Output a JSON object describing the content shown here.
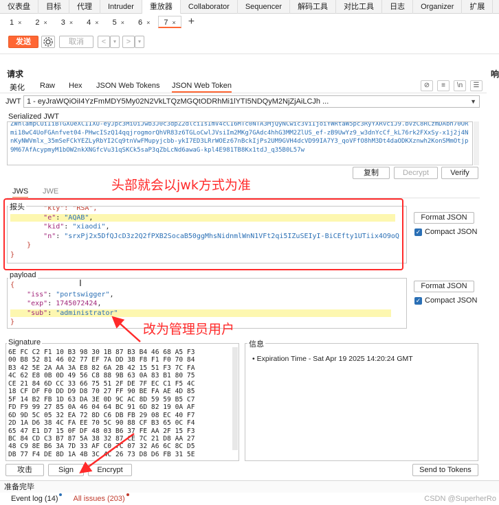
{
  "top_tabs": [
    "仪表盘",
    "目标",
    "代理",
    "Intruder",
    "重放器",
    "Collaborator",
    "Sequencer",
    "解码工具",
    "对比工具",
    "日志",
    "Organizer",
    "扩展",
    "学"
  ],
  "active_top_tab": "重放器",
  "repeater_tabs": [
    {
      "label": "1",
      "close": "×"
    },
    {
      "label": "2",
      "close": "×"
    },
    {
      "label": "3",
      "close": "×"
    },
    {
      "label": "4",
      "close": "×"
    },
    {
      "label": "5",
      "close": "×"
    },
    {
      "label": "6",
      "close": "×"
    },
    {
      "label": "7",
      "close": "×"
    }
  ],
  "add_tab_glyph": "+",
  "toolbar": {
    "send_label": "发送",
    "cancel_label": "取消",
    "back_glyph": "<",
    "fwd_glyph": ">",
    "dropdown_glyph": "▾"
  },
  "request": {
    "title": "请求",
    "response_title": "响",
    "subtabs": [
      "美化",
      "Raw",
      "Hex",
      "JSON Web Tokens",
      "JSON Web Token"
    ],
    "active_subtab": "JSON Web Token"
  },
  "jwt": {
    "label": "JWT",
    "selected": "1 - eyJraWQiOiI4YzFmMDY5My02N2VkLTQzMGQtODRhMi1lYTI5NDQyM2NjZjAiLCJh ...",
    "serialized_label": "Serialized JWT",
    "serialized_text": "ZWhlampCUiIiBTGXUeXCIIXU-eyJpc3MiOiJwb3J0c3dpZ2dlciIsImV4cCI6MTc0NTA3MjQyNCwic3ViIjoiYWRtaW5pc3RyYXRvciJ9.bvzC8RCzmDAbh70ORmi18wC4UoFGAnfvet04-PHwcISzQ14qqjrogmorQhVR83z6TGLoCwlJVsiIm2MKg7GAdc4hhG3MM2ZlUS_ef-zB9UwYz9_w3dnYcCf_kL76rk2FXxSy-x1j2j4NnKyNWVmlx_35mSeFCkYEZLyRbYI2Cq9tnVwFMupyjcbb-ykI7ED3LRrWOEz67nBckIjPs2UM9GVH4dcVD99IA7Y3_qoVFfO8hM3Dt4daODKXznwh2KonSMmOtjp9M67AfAcypmyM1bOW2nkXNGfcVu31qSKCk5saP3qZbLcNd6awaG-kpl4E981TB8Kx1tdJ_q35B0L57w",
    "copy_label": "复制",
    "decrypt_label": "Decrypt",
    "verify_label": "Verify"
  },
  "jws_tabs": [
    "JWS",
    "JWE"
  ],
  "header_panel": {
    "label": "报头",
    "format_label": "Format JSON",
    "compact_label": "Compact JSON",
    "compact_checked": "✓"
  },
  "payload_panel": {
    "label": "payload",
    "format_label": "Format JSON",
    "compact_label": "Compact JSON",
    "compact_checked": "✓"
  },
  "signature": {
    "label": "Signature",
    "hex_rows": [
      "6E FC C2 F1 10 B3 98 30 1B 87 B3 B4 46 68 A5 F3",
      "00 B8 52 81 46 02 77 EF 7A DD 38 F8 F1 F0 70 84",
      "B3 42 5E 2A AA 3A E8 82 6A 2B 42 15 51 F3 7C FA",
      "4C 62 E8 0B 0D 49 56 C8 88 9B 63 0A 83 B1 80 75",
      "CE 21 84 6D CC 33 66 75 51 2F DE 7F EC C1 F5 4C",
      "18 CF DF F0 DD D9 D8 70 27 FF 90 BE FA AE 4D 85",
      "5F 14 B2 FB 1D 63 DA 3E 0D 9C AC 8D 59 59 B5 C7",
      "FD F9 99 27 85 0A 46 04 64 BC 91 6D 82 19 0A AF",
      "6D 9D 5C 05 32 EA 72 8D C6 DB FB 29 08 EC 40 F7",
      "2D 1A D6 38 4C FA EE 70 5C 90 88 CF B3 65 0C F4",
      "65 47 E1 D7 15 0F DF 48 03 B6 37 FE AA 2F 15 F3",
      "BC 84 CD C3 B7 87 5A 38 32 87 CE 7C 21 D8 AA 27",
      "48 C9 8E B6 3A 7D 33 AF C0 7C 07 32 A6 6C 8C D5",
      "DB 77 F4 DE 8D 1A 4B 3C 4C 26 73 D8 D6 FB 31 5E"
    ]
  },
  "info": {
    "label": "信息",
    "bullet": "Expiration Time - Sat Apr 19 2025 14:20:24 GMT"
  },
  "bottom_buttons": {
    "attack_label": "攻击",
    "sign_label": "Sign",
    "encrypt_label": "Encrypt",
    "send_to_tokens_label": "Send to Tokens"
  },
  "status": "准备完毕",
  "footer": {
    "event_log": "Event log (14)",
    "all_issues": "All issues (203)"
  },
  "watermark": "CSDN @SuperherRo",
  "annotations": {
    "header_note": "头部就会以jwk方式为准",
    "payload_note": "改为管理员用户"
  },
  "colors": {
    "accent": "#ff6633",
    "annotation_red": "#ff2a2a",
    "highlight": "#fdf7b0",
    "json_key": "#a1257a",
    "json_string": "#2a6fb5"
  }
}
